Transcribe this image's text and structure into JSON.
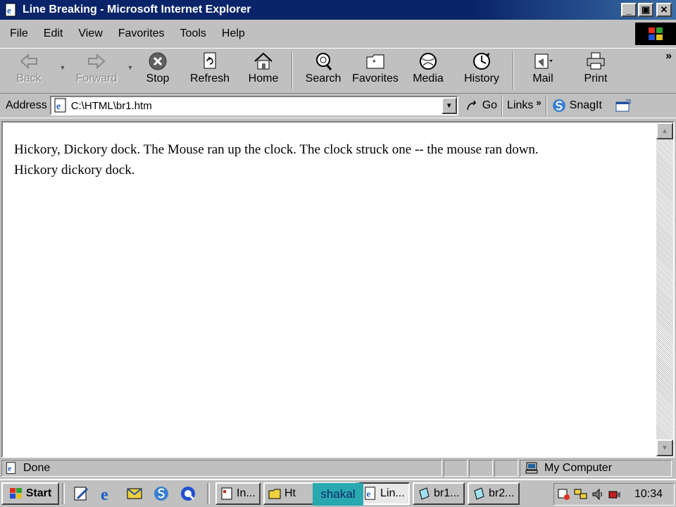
{
  "window": {
    "title": "Line Breaking - Microsoft Internet Explorer",
    "controls": {
      "minimize": "_",
      "maximize": "▣",
      "close": "✕"
    }
  },
  "menu": [
    "File",
    "Edit",
    "View",
    "Favorites",
    "Tools",
    "Help"
  ],
  "toolbar": {
    "back": "Back",
    "forward": "Forward",
    "stop": "Stop",
    "refresh": "Refresh",
    "home": "Home",
    "search": "Search",
    "favorites": "Favorites",
    "media": "Media",
    "history": "History",
    "mail": "Mail",
    "print": "Print",
    "more": "»"
  },
  "address": {
    "label": "Address",
    "value": "C:\\HTML\\br1.htm",
    "go": "Go",
    "links": "Links",
    "links_more": "»",
    "snagit": "SnagIt"
  },
  "page": {
    "text_line1": "Hickory, Dickory dock. The Mouse ran up the clock. The clock struck one -- the mouse ran down.",
    "text_line2": "Hickory dickory dock."
  },
  "status": {
    "text": "Done",
    "zone": "My Computer"
  },
  "taskbar": {
    "start": "Start",
    "tasks": [
      "In...",
      "Ht",
      "Lin...",
      "br1...",
      "br2..."
    ],
    "overlay": "shakal",
    "clock": "10:34"
  },
  "colors": {
    "titlebar": "#0a246a",
    "chrome": "#c0c0c0",
    "content_bg": "#ffffff"
  }
}
